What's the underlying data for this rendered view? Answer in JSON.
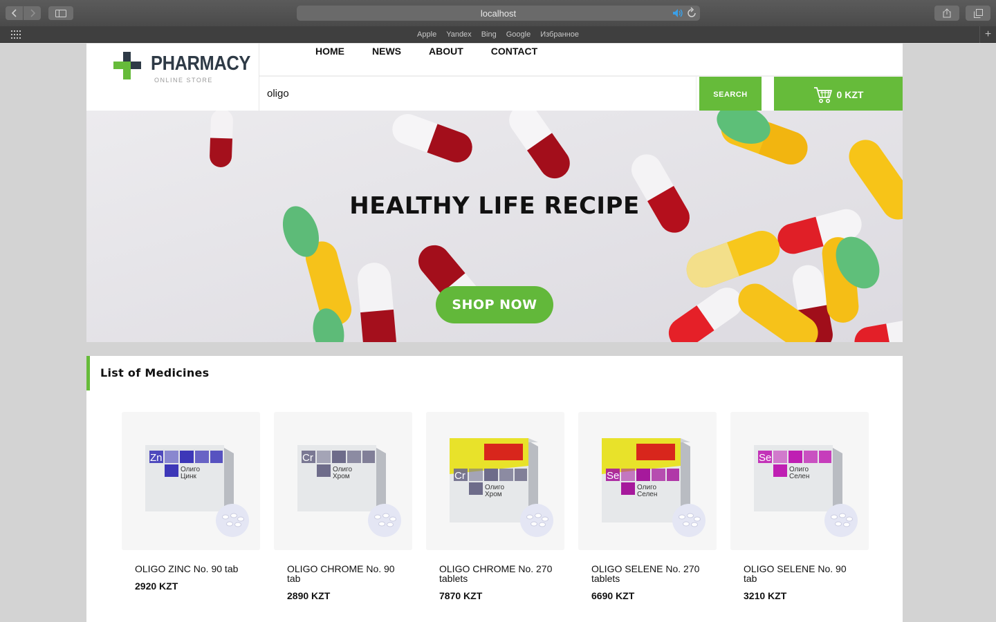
{
  "browser": {
    "url": "localhost",
    "favorites": [
      "Apple",
      "Yandex",
      "Bing",
      "Google",
      "Избранное"
    ]
  },
  "site": {
    "logo_title": "PHARMACY",
    "logo_subtitle": "ONLINE STORE",
    "nav": [
      "HOME",
      "NEWS",
      "ABOUT",
      "CONTACT"
    ],
    "search": {
      "value": "oligo",
      "button_label": "SEARCH"
    },
    "cart": {
      "total": "0 KZT"
    },
    "accent_color": "#66bb3a"
  },
  "hero": {
    "title": "HEALTHY LIFE RECIPE",
    "button_label": "SHOP NOW"
  },
  "list": {
    "title": "List of Medicines",
    "products": [
      {
        "name": "OLIGO ZINC No. 90 tab",
        "price": "2920 KZT",
        "box_text": "Zn",
        "box_label_1": "Олиго",
        "box_label_2": "Цинк",
        "color": "#3d37b8"
      },
      {
        "name": "OLIGO CHROME No. 90 tab",
        "price": "2890 KZT",
        "box_text": "Cr",
        "box_label_1": "Олиго",
        "box_label_2": "Хром",
        "color": "#6e6c8a"
      },
      {
        "name": "OLIGO CHROME No. 270 tablets",
        "price": "7870 KZT",
        "box_text": "Cr",
        "box_label_1": "Олиго",
        "box_label_2": "Хром",
        "color": "#6e6c8a"
      },
      {
        "name": "OLIGO SELENE No. 270 tablets",
        "price": "6690 KZT",
        "box_text": "Se",
        "box_label_1": "Олиго",
        "box_label_2": "Селен",
        "color": "#a6199c"
      },
      {
        "name": "OLIGO SELENE No. 90 tab",
        "price": "3210 KZT",
        "box_text": "Se",
        "box_label_1": "Олиго",
        "box_label_2": "Селен",
        "color": "#bf1fb3"
      }
    ]
  }
}
